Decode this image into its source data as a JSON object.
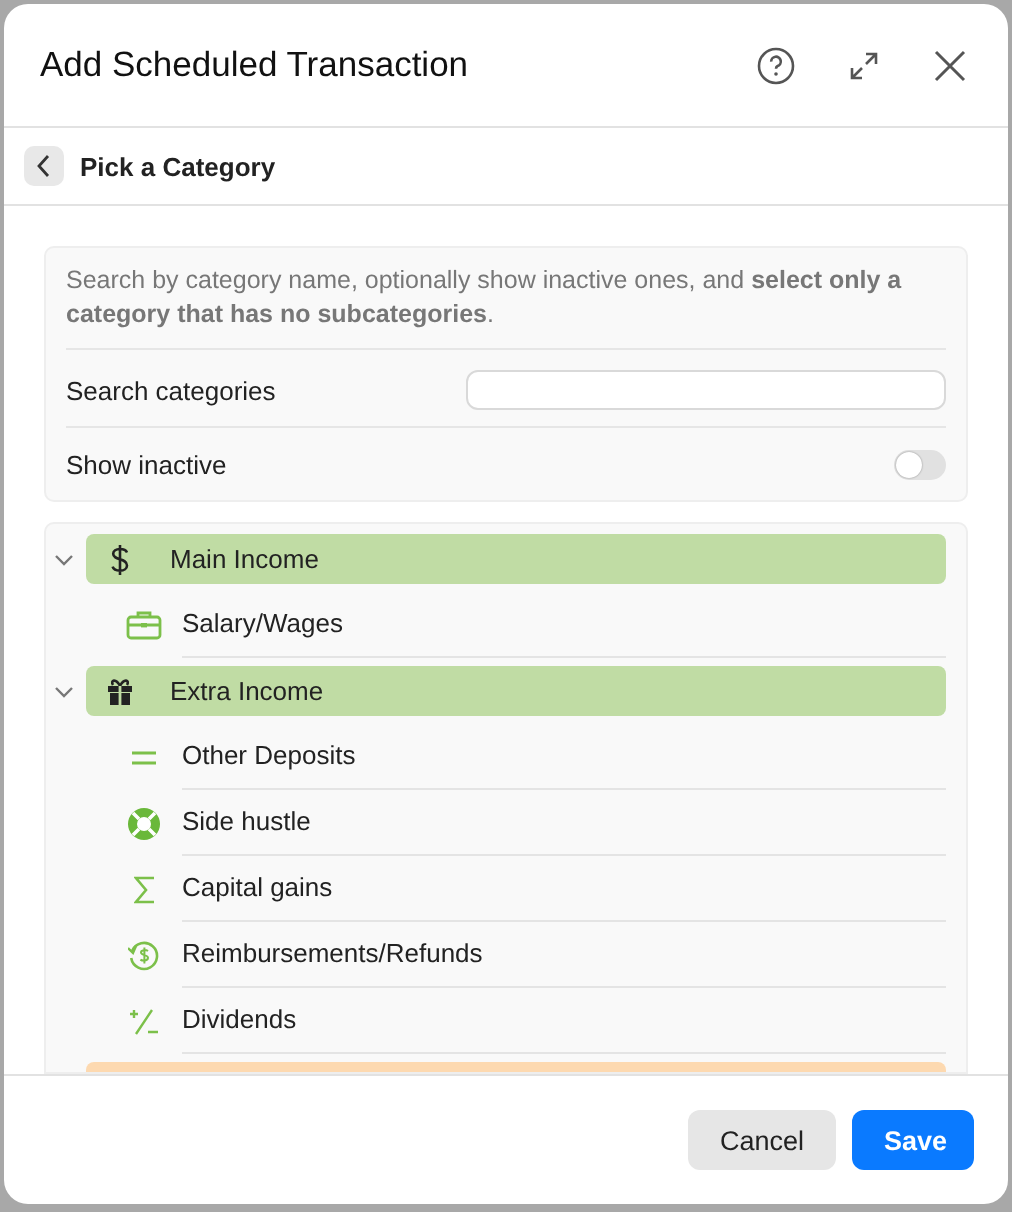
{
  "window": {
    "title": "Add Scheduled Transaction"
  },
  "subheader": {
    "title": "Pick a Category"
  },
  "info": {
    "text": "Search by category name, optionally show inactive ones, and **select only a category that has no subcategories**."
  },
  "search": {
    "label": "Search categories"
  },
  "show_inactive": {
    "label": "Show inactive",
    "on": false
  },
  "categories": [
    {
      "label": "Main Income",
      "color": "#c0dca4",
      "expanded": true,
      "children": [
        {
          "label": "Salary/Wages"
        }
      ]
    },
    {
      "label": "Extra Income",
      "color": "#c0dca4",
      "expanded": true,
      "children": [
        {
          "label": "Other Deposits"
        },
        {
          "label": "Side hustle"
        },
        {
          "label": "Capital gains"
        },
        {
          "label": "Reimbursements/Refunds"
        },
        {
          "label": "Dividends"
        }
      ]
    },
    {
      "color": "#fdd9b0"
    }
  ],
  "buttons": {
    "cancel": "Cancel",
    "save": "Save"
  }
}
